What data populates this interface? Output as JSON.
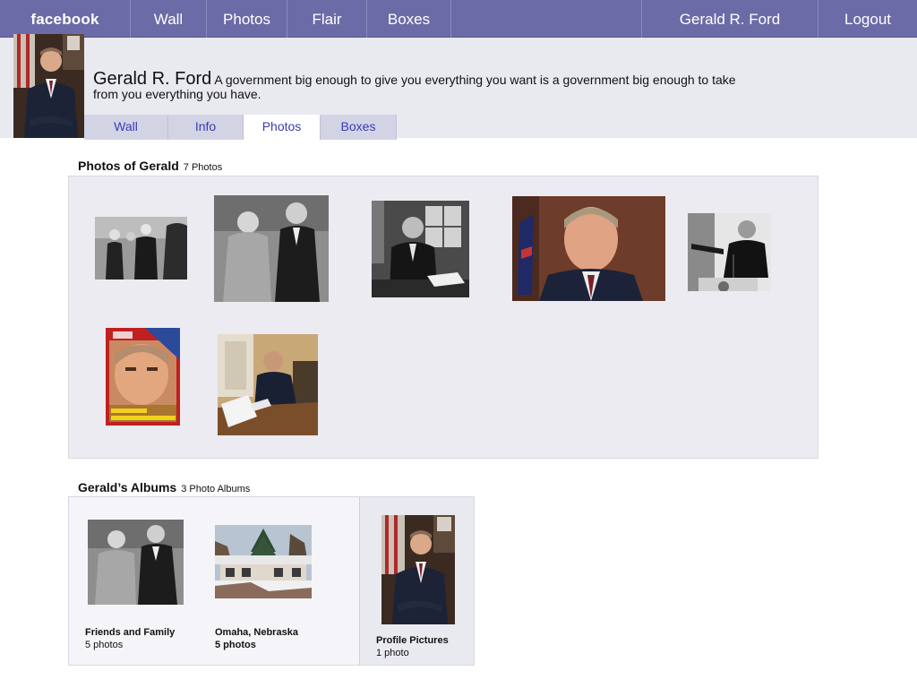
{
  "nav": {
    "logo": "facebook",
    "items": [
      {
        "label": "Wall"
      },
      {
        "label": "Photos"
      },
      {
        "label": "Flair"
      },
      {
        "label": "Boxes"
      }
    ],
    "user": "Gerald R. Ford",
    "logout": "Logout"
  },
  "profile": {
    "name": "Gerald R. Ford",
    "status": "A government big enough to give you everything you want is a government big enough to take from you everything you have."
  },
  "tabs": [
    {
      "label": "Wall",
      "active": false
    },
    {
      "label": "Info",
      "active": false
    },
    {
      "label": "Photos",
      "active": true
    },
    {
      "label": "Boxes",
      "active": false
    }
  ],
  "photos_section": {
    "title": "Photos of Gerald",
    "count": "7 Photos"
  },
  "albums_section": {
    "title": "Gerald’s Albums",
    "count": "3 Photo Albums",
    "albums": [
      {
        "title": "Friends and Family",
        "count": "5 photos"
      },
      {
        "title": "Omaha,  Nebraska",
        "count": "5 photos"
      },
      {
        "title": "Profile Pictures",
        "count": "1 photo"
      }
    ]
  },
  "colors": {
    "topbar": "#6b6ba7",
    "header_bg": "#e9e9f0",
    "tab_bg": "#d3d3e6",
    "link": "#3b3bb0"
  }
}
